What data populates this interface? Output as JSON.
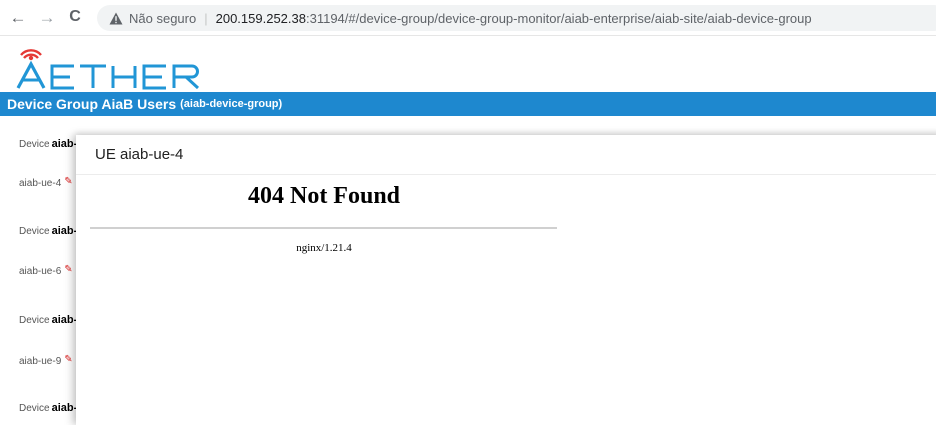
{
  "browser": {
    "back_icon": "arrow-left-icon",
    "forward_icon": "arrow-right-icon",
    "reload_icon": "reload-icon",
    "security_label": "Não seguro",
    "url_host": "200.159.252.38",
    "url_rest": ":31194/#/device-group/device-group-monitor/aiab-enterprise/aiab-site/aiab-device-group"
  },
  "app": {
    "logo_text": "AETHER",
    "brand_color": "#1e88cf",
    "page_title": "Device Group AiaB Users",
    "page_title_sub": "(aiab-device-group)"
  },
  "sidebar": {
    "items": [
      {
        "prefix": "Device",
        "name": "aiab-"
      },
      {
        "ue": "aiab-ue-4"
      },
      {
        "prefix": "Device",
        "name": "aiab-"
      },
      {
        "ue": "aiab-ue-6"
      },
      {
        "prefix": "Device",
        "name": "aiab-"
      },
      {
        "ue": "aiab-ue-9"
      },
      {
        "prefix": "Device",
        "name": "aiab-"
      }
    ]
  },
  "dialog": {
    "title": "UE aiab-ue-4",
    "error_title": "404 Not Found",
    "server": "nginx/1.21.4"
  }
}
